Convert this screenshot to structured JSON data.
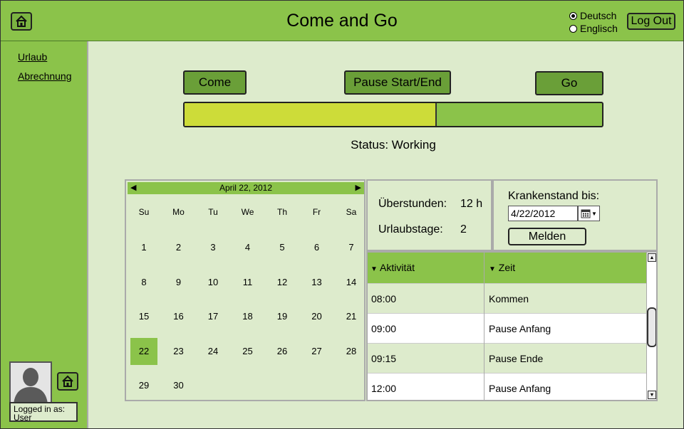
{
  "header": {
    "title": "Come and Go",
    "languages": [
      {
        "label": "Deutsch",
        "selected": true
      },
      {
        "label": "Englisch",
        "selected": false
      }
    ],
    "logout_label": "Log Out"
  },
  "sidebar": {
    "links": [
      "Urlaub",
      "Abrechnung"
    ],
    "logged_in_label": "Logged in as:",
    "user": "User"
  },
  "actions": {
    "come_label": "Come",
    "pause_label": "Pause Start/End",
    "go_label": "Go"
  },
  "progress": {
    "fraction": 0.6
  },
  "status": {
    "text": "Status: Working"
  },
  "calendar": {
    "title": "April 22, 2012",
    "weekdays": [
      "Su",
      "Mo",
      "Tu",
      "We",
      "Th",
      "Fr",
      "Sa"
    ],
    "weeks": [
      [
        "1",
        "2",
        "3",
        "4",
        "5",
        "6",
        "7"
      ],
      [
        "8",
        "9",
        "10",
        "11",
        "12",
        "13",
        "14"
      ],
      [
        "15",
        "16",
        "17",
        "18",
        "19",
        "20",
        "21"
      ],
      [
        "22",
        "23",
        "24",
        "25",
        "26",
        "27",
        "28"
      ],
      [
        "29",
        "30",
        "",
        "",
        "",
        "",
        ""
      ]
    ],
    "selected_day": "22"
  },
  "stats": {
    "overtime_label": "Überstunden:",
    "overtime_value": "12 h",
    "vacation_label": "Urlaubstage:",
    "vacation_value": "2"
  },
  "sick_leave": {
    "label": "Krankenstand bis:",
    "date": "4/22/2012",
    "submit_label": "Melden"
  },
  "activity_table": {
    "headers": [
      "Aktivität",
      "Zeit"
    ],
    "rows": [
      [
        "08:00",
        "Kommen"
      ],
      [
        "09:00",
        "Pause Anfang"
      ],
      [
        "09:15",
        "Pause Ende"
      ],
      [
        "12:00",
        "Pause Anfang"
      ]
    ]
  },
  "colors": {
    "header_green": "#8bc34a",
    "button_green": "#6a9f38",
    "panel_bg": "#ddebcc",
    "progress_yellow": "#cddc39"
  }
}
